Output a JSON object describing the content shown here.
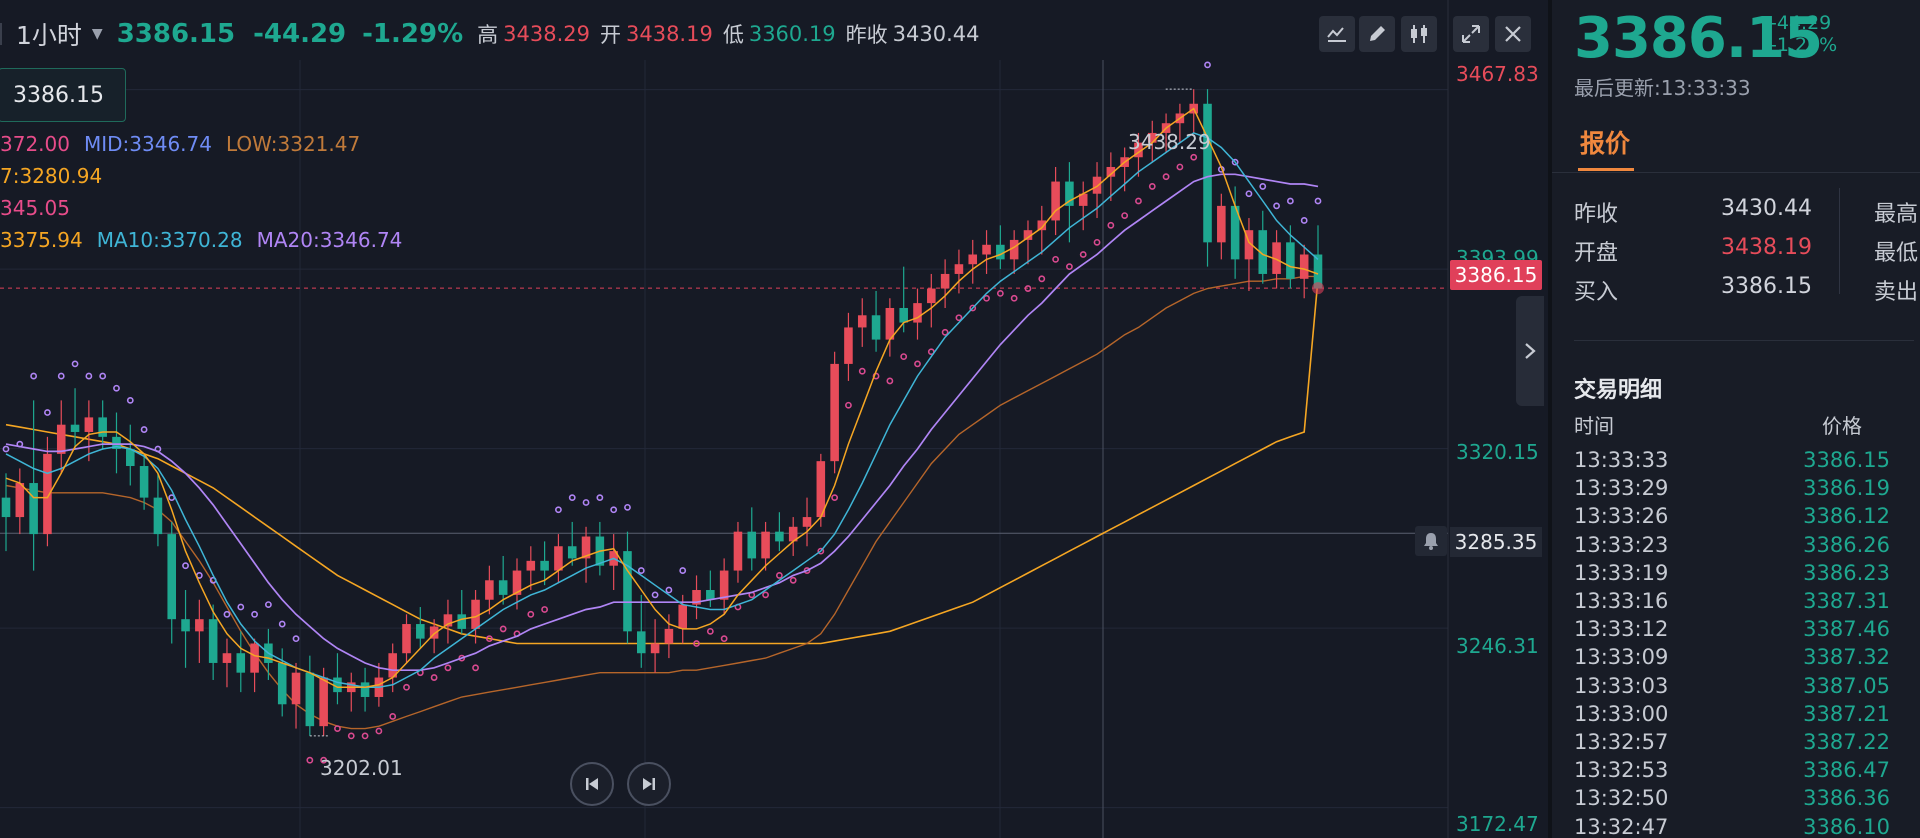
{
  "header": {
    "timeframe": "1小时",
    "price": "3386.15",
    "change": "-44.29",
    "change_pct": "-1.29%",
    "high_label": "高",
    "high": "3438.29",
    "open_label": "开",
    "open": "3438.19",
    "low_label": "低",
    "low": "3360.19",
    "prev_label": "昨收",
    "prev": "3430.44"
  },
  "toolbar": {
    "icons": [
      "indicator-icon",
      "draw-pen-icon",
      "candle-style-icon",
      "collapse-icon",
      "close-icon"
    ]
  },
  "price_box": "3386.15",
  "indicators": {
    "boll": {
      "up": "372.00",
      "mid": "MID:3346.74",
      "low": "LOW:3321.47"
    },
    "line2": "7:3280.94",
    "line3": "345.05",
    "ma5": "3375.94",
    "ma10": "MA10:3370.28",
    "ma20": "MA20:3346.74"
  },
  "y_axis": {
    "labels": [
      "3467.83",
      "3393.99",
      "3320.15",
      "3246.31",
      "3172.47"
    ],
    "current_price_tag": "3386.15",
    "crosshair_tag": "3285.35"
  },
  "extreme_labels": {
    "high": "3438.29",
    "low": "3202.01"
  },
  "colors": {
    "up": "#e74c5a",
    "down": "#1ea890",
    "ma5": "#f5a623",
    "ma10": "#3fb5d6",
    "ma20": "#b085f5",
    "boll_lower": "#b5652a",
    "long_ma": "#f5a623",
    "sar": "#d94a90",
    "bg": "#161a25",
    "accent": "#f0883e"
  },
  "right_panel": {
    "price": "3386.15",
    "change": "-44.29",
    "change_pct": "-1.29%",
    "updated": "最后更新:13:33:33",
    "tab": "报价",
    "quotes": [
      {
        "label": "昨收",
        "value": "3430.44",
        "label2": "最高",
        "color": "#d1d4dc"
      },
      {
        "label": "开盘",
        "value": "3438.19",
        "label2": "最低",
        "color": "#e74c5a"
      },
      {
        "label": "买入",
        "value": "3386.15",
        "label2": "卖出",
        "color": "#d1d4dc"
      }
    ],
    "trades_title": "交易明细",
    "trades_col_time": "时间",
    "trades_col_price": "价格",
    "trades": [
      {
        "time": "13:33:33",
        "price": "3386.15"
      },
      {
        "time": "13:33:29",
        "price": "3386.19"
      },
      {
        "time": "13:33:26",
        "price": "3386.12"
      },
      {
        "time": "13:33:23",
        "price": "3386.26"
      },
      {
        "time": "13:33:19",
        "price": "3386.23"
      },
      {
        "time": "13:33:16",
        "price": "3387.31"
      },
      {
        "time": "13:33:12",
        "price": "3387.46"
      },
      {
        "time": "13:33:09",
        "price": "3387.32"
      },
      {
        "time": "13:33:03",
        "price": "3387.05"
      },
      {
        "time": "13:33:00",
        "price": "3387.21"
      },
      {
        "time": "13:32:57",
        "price": "3387.22"
      },
      {
        "time": "13:32:53",
        "price": "3386.47"
      },
      {
        "time": "13:32:50",
        "price": "3386.36"
      },
      {
        "time": "13:32:47",
        "price": "3386.10"
      }
    ]
  },
  "chart_data": {
    "type": "candlestick",
    "interval": "1h",
    "y_range": [
      3160,
      3480
    ],
    "y_ticks": [
      3467.83,
      3393.99,
      3320.15,
      3246.31,
      3172.47
    ],
    "last_price": 3386.15,
    "crosshair_price": 3285.35,
    "high": 3438.29,
    "low": 3202.01,
    "ohlc": [
      [
        3300,
        3310,
        3278,
        3292
      ],
      [
        3292,
        3312,
        3285,
        3306
      ],
      [
        3306,
        3340,
        3270,
        3285
      ],
      [
        3285,
        3325,
        3280,
        3318
      ],
      [
        3318,
        3340,
        3310,
        3330
      ],
      [
        3330,
        3345,
        3320,
        3327
      ],
      [
        3327,
        3340,
        3315,
        3333
      ],
      [
        3333,
        3340,
        3320,
        3325
      ],
      [
        3325,
        3335,
        3310,
        3320
      ],
      [
        3320,
        3330,
        3305,
        3313
      ],
      [
        3313,
        3318,
        3295,
        3300
      ],
      [
        3300,
        3310,
        3280,
        3285
      ],
      [
        3285,
        3290,
        3240,
        3250
      ],
      [
        3250,
        3262,
        3230,
        3245
      ],
      [
        3245,
        3258,
        3232,
        3250
      ],
      [
        3250,
        3256,
        3225,
        3232
      ],
      [
        3232,
        3242,
        3222,
        3236
      ],
      [
        3236,
        3245,
        3220,
        3228
      ],
      [
        3228,
        3242,
        3220,
        3240
      ],
      [
        3240,
        3246,
        3225,
        3232
      ],
      [
        3232,
        3238,
        3210,
        3215
      ],
      [
        3215,
        3232,
        3205,
        3228
      ],
      [
        3228,
        3235,
        3202,
        3206
      ],
      [
        3206,
        3230,
        3202,
        3226
      ],
      [
        3226,
        3236,
        3215,
        3220
      ],
      [
        3220,
        3228,
        3212,
        3224
      ],
      [
        3224,
        3230,
        3212,
        3218
      ],
      [
        3218,
        3232,
        3214,
        3226
      ],
      [
        3226,
        3240,
        3220,
        3236
      ],
      [
        3236,
        3252,
        3232,
        3248
      ],
      [
        3248,
        3255,
        3238,
        3242
      ],
      [
        3242,
        3250,
        3236,
        3247
      ],
      [
        3247,
        3258,
        3240,
        3252
      ],
      [
        3252,
        3262,
        3244,
        3246
      ],
      [
        3246,
        3262,
        3240,
        3258
      ],
      [
        3258,
        3272,
        3252,
        3266
      ],
      [
        3266,
        3276,
        3256,
        3260
      ],
      [
        3260,
        3275,
        3254,
        3270
      ],
      [
        3270,
        3280,
        3262,
        3274
      ],
      [
        3274,
        3282,
        3264,
        3270
      ],
      [
        3270,
        3285,
        3265,
        3280
      ],
      [
        3280,
        3290,
        3272,
        3275
      ],
      [
        3275,
        3288,
        3265,
        3284
      ],
      [
        3284,
        3290,
        3268,
        3272
      ],
      [
        3272,
        3285,
        3262,
        3278
      ],
      [
        3278,
        3286,
        3240,
        3245
      ],
      [
        3245,
        3260,
        3230,
        3236
      ],
      [
        3236,
        3250,
        3228,
        3240
      ],
      [
        3240,
        3252,
        3234,
        3246
      ],
      [
        3246,
        3260,
        3240,
        3256
      ],
      [
        3256,
        3268,
        3250,
        3262
      ],
      [
        3262,
        3270,
        3255,
        3258
      ],
      [
        3258,
        3275,
        3252,
        3270
      ],
      [
        3270,
        3290,
        3265,
        3286
      ],
      [
        3286,
        3296,
        3270,
        3275
      ],
      [
        3275,
        3290,
        3270,
        3286
      ],
      [
        3286,
        3294,
        3278,
        3282
      ],
      [
        3282,
        3292,
        3276,
        3288
      ],
      [
        3288,
        3300,
        3280,
        3292
      ],
      [
        3292,
        3318,
        3288,
        3315
      ],
      [
        3315,
        3360,
        3310,
        3355
      ],
      [
        3355,
        3376,
        3348,
        3370
      ],
      [
        3370,
        3382,
        3362,
        3375
      ],
      [
        3375,
        3385,
        3360,
        3365
      ],
      [
        3365,
        3382,
        3358,
        3378
      ],
      [
        3378,
        3395,
        3368,
        3372
      ],
      [
        3372,
        3386,
        3365,
        3380
      ],
      [
        3380,
        3392,
        3370,
        3386
      ],
      [
        3386,
        3398,
        3378,
        3392
      ],
      [
        3392,
        3402,
        3384,
        3396
      ],
      [
        3396,
        3406,
        3388,
        3400
      ],
      [
        3400,
        3410,
        3392,
        3404
      ],
      [
        3404,
        3412,
        3394,
        3398
      ],
      [
        3398,
        3410,
        3392,
        3406
      ],
      [
        3406,
        3414,
        3396,
        3410
      ],
      [
        3410,
        3420,
        3400,
        3414
      ],
      [
        3414,
        3436,
        3408,
        3430
      ],
      [
        3430,
        3438,
        3405,
        3420
      ],
      [
        3420,
        3430,
        3410,
        3425
      ],
      [
        3425,
        3438,
        3415,
        3432
      ],
      [
        3432,
        3442,
        3422,
        3436
      ],
      [
        3436,
        3444,
        3426,
        3440
      ],
      [
        3440,
        3450,
        3432,
        3446
      ],
      [
        3446,
        3455,
        3438,
        3450
      ],
      [
        3450,
        3458,
        3442,
        3454
      ],
      [
        3454,
        3462,
        3446,
        3458
      ],
      [
        3458,
        3468,
        3450,
        3462
      ],
      [
        3462,
        3468,
        3395,
        3405
      ],
      [
        3405,
        3425,
        3398,
        3420
      ],
      [
        3420,
        3428,
        3390,
        3398
      ],
      [
        3398,
        3415,
        3385,
        3410
      ],
      [
        3410,
        3418,
        3388,
        3392
      ],
      [
        3392,
        3410,
        3386,
        3405
      ],
      [
        3405,
        3412,
        3386,
        3390
      ],
      [
        3390,
        3404,
        3382,
        3400
      ],
      [
        3400,
        3412,
        3388,
        3386
      ]
    ],
    "ma5": [
      3308,
      3306,
      3300,
      3300,
      3310,
      3321,
      3326,
      3327,
      3327,
      3323,
      3318,
      3310,
      3295,
      3278,
      3265,
      3253,
      3244,
      3238,
      3235,
      3234,
      3232,
      3230,
      3228,
      3225,
      3222,
      3222,
      3222,
      3223,
      3226,
      3232,
      3238,
      3244,
      3248,
      3250,
      3251,
      3254,
      3258,
      3261,
      3264,
      3266,
      3270,
      3274,
      3276,
      3278,
      3279,
      3270,
      3262,
      3254,
      3248,
      3246,
      3246,
      3248,
      3252,
      3260,
      3266,
      3272,
      3277,
      3282,
      3286,
      3292,
      3305,
      3322,
      3337,
      3352,
      3365,
      3372,
      3374,
      3378,
      3383,
      3389,
      3394,
      3398,
      3400,
      3403,
      3407,
      3411,
      3418,
      3422,
      3425,
      3428,
      3433,
      3438,
      3442,
      3446,
      3452,
      3456,
      3460,
      3448,
      3436,
      3420,
      3405,
      3400,
      3398,
      3395,
      3394,
      3392
    ],
    "ma10": [
      3318,
      3315,
      3312,
      3310,
      3312,
      3315,
      3318,
      3320,
      3321,
      3320,
      3317,
      3312,
      3303,
      3291,
      3280,
      3268,
      3257,
      3248,
      3241,
      3236,
      3233,
      3230,
      3228,
      3226,
      3224,
      3223,
      3222,
      3222,
      3223,
      3226,
      3229,
      3234,
      3238,
      3242,
      3246,
      3250,
      3254,
      3257,
      3260,
      3262,
      3265,
      3268,
      3271,
      3273,
      3275,
      3272,
      3268,
      3264,
      3260,
      3256,
      3255,
      3254,
      3254,
      3256,
      3258,
      3262,
      3266,
      3270,
      3274,
      3278,
      3285,
      3295,
      3306,
      3318,
      3330,
      3340,
      3350,
      3358,
      3366,
      3372,
      3378,
      3384,
      3389,
      3393,
      3397,
      3401,
      3406,
      3411,
      3415,
      3419,
      3424,
      3429,
      3434,
      3438,
      3442,
      3446,
      3450,
      3448,
      3444,
      3438,
      3430,
      3422,
      3414,
      3408,
      3403,
      3398
    ],
    "ma20": [
      3322,
      3321,
      3320,
      3319,
      3319,
      3320,
      3321,
      3322,
      3322,
      3322,
      3321,
      3319,
      3315,
      3310,
      3304,
      3297,
      3289,
      3281,
      3273,
      3265,
      3258,
      3252,
      3247,
      3242,
      3238,
      3235,
      3232,
      3230,
      3229,
      3229,
      3229,
      3230,
      3232,
      3234,
      3236,
      3239,
      3241,
      3243,
      3246,
      3248,
      3250,
      3252,
      3254,
      3255,
      3257,
      3257,
      3257,
      3257,
      3257,
      3257,
      3257,
      3258,
      3259,
      3260,
      3261,
      3263,
      3265,
      3268,
      3270,
      3273,
      3278,
      3284,
      3291,
      3298,
      3305,
      3313,
      3320,
      3328,
      3335,
      3342,
      3349,
      3356,
      3363,
      3369,
      3375,
      3380,
      3386,
      3392,
      3396,
      3400,
      3405,
      3410,
      3414,
      3418,
      3422,
      3426,
      3430,
      3432,
      3433,
      3433,
      3432,
      3431,
      3430,
      3429,
      3429,
      3428
    ],
    "boll_lower": [
      3305,
      3304,
      3303,
      3302,
      3302,
      3302,
      3302,
      3302,
      3301,
      3300,
      3298,
      3295,
      3290,
      3282,
      3274,
      3265,
      3255,
      3245,
      3236,
      3228,
      3221,
      3215,
      3211,
      3208,
      3206,
      3205,
      3205,
      3206,
      3208,
      3210,
      3212,
      3214,
      3216,
      3218,
      3219,
      3220,
      3221,
      3222,
      3223,
      3224,
      3225,
      3226,
      3227,
      3228,
      3228,
      3228,
      3228,
      3228,
      3228,
      3229,
      3229,
      3230,
      3231,
      3232,
      3233,
      3234,
      3236,
      3238,
      3240,
      3244,
      3252,
      3262,
      3272,
      3282,
      3290,
      3298,
      3306,
      3314,
      3320,
      3326,
      3330,
      3334,
      3338,
      3341,
      3344,
      3347,
      3350,
      3353,
      3356,
      3359,
      3363,
      3367,
      3370,
      3374,
      3378,
      3381,
      3384,
      3386,
      3387,
      3388,
      3389,
      3389,
      3390,
      3390,
      3391,
      3391
    ],
    "long_ma": [
      3330,
      3329,
      3328,
      3327,
      3326,
      3325,
      3324,
      3323,
      3322,
      3320,
      3318,
      3316,
      3313,
      3310,
      3307,
      3304,
      3300,
      3296,
      3292,
      3288,
      3284,
      3280,
      3276,
      3272,
      3268,
      3265,
      3262,
      3259,
      3256,
      3253,
      3250,
      3248,
      3246,
      3244,
      3243,
      3242,
      3241,
      3240,
      3240,
      3240,
      3240,
      3240,
      3240,
      3240,
      3240,
      3240,
      3240,
      3240,
      3240,
      3240,
      3240,
      3240,
      3240,
      3240,
      3240,
      3240,
      3240,
      3240,
      3240,
      3240,
      3241,
      3242,
      3243,
      3244,
      3245,
      3247,
      3249,
      3251,
      3253,
      3255,
      3257,
      3260,
      3263,
      3266,
      3269,
      3272,
      3275,
      3278,
      3281,
      3284,
      3287,
      3290,
      3293,
      3296,
      3299,
      3302,
      3305,
      3308,
      3311,
      3314,
      3317,
      3320,
      3323,
      3325,
      3327,
      3390
    ]
  }
}
